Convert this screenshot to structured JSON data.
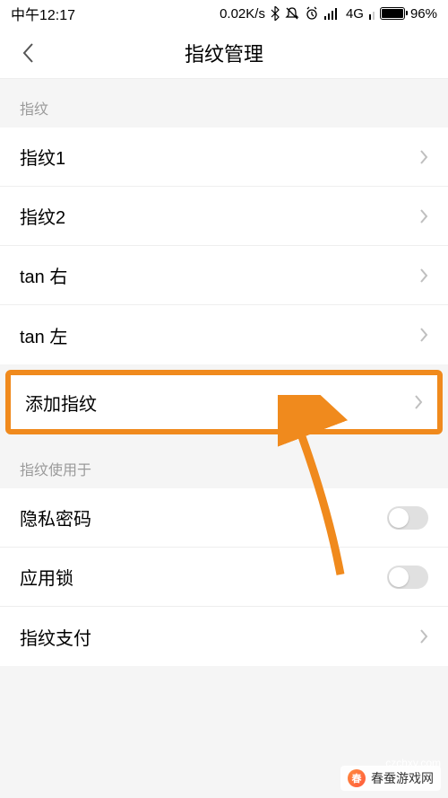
{
  "statusbar": {
    "time": "中午12:17",
    "speed": "0.02K/s",
    "network": "4G",
    "battery": "96%"
  },
  "header": {
    "title": "指纹管理"
  },
  "sections": {
    "fingerprints_label": "指纹",
    "usage_label": "指纹使用于"
  },
  "fingerprints": [
    {
      "label": "指纹1"
    },
    {
      "label": "指纹2"
    },
    {
      "label": "tan 右"
    },
    {
      "label": "tan 左"
    }
  ],
  "add_fingerprint_label": "添加指纹",
  "usage": {
    "privacy_password": "隐私密码",
    "app_lock": "应用锁",
    "fingerprint_pay": "指纹支付"
  },
  "toggles": {
    "privacy_password": false,
    "app_lock": false
  },
  "watermark": {
    "text": "春蚕游戏网",
    "url": "czchxy.com"
  },
  "annotation": {
    "highlight_color": "#f08a1d"
  }
}
